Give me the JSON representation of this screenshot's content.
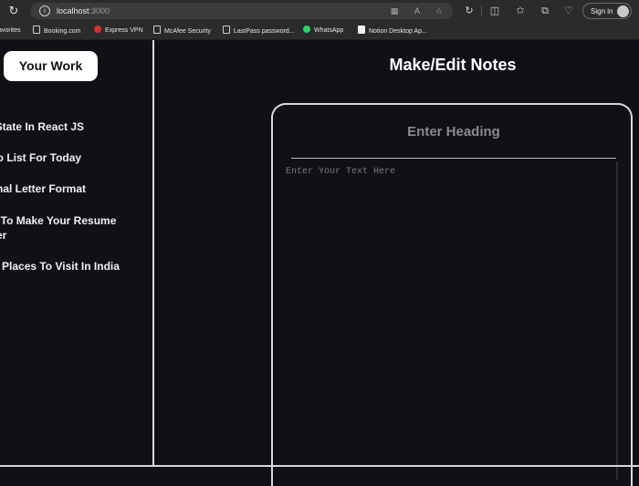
{
  "browser": {
    "url_host": "localhost",
    "url_port": ":3000",
    "signin_label": "Sign in"
  },
  "bookmarks": [
    {
      "label": "avorites"
    },
    {
      "label": "Booking.com"
    },
    {
      "label": "Express VPN"
    },
    {
      "label": "McAfee Security"
    },
    {
      "label": "LastPass password..."
    },
    {
      "label": "WhatsApp"
    },
    {
      "label": "Notion Desktop Ap..."
    }
  ],
  "sidebar": {
    "your_work_label": "Your Work",
    "notes": [
      {
        "title": "eState In React JS"
      },
      {
        "title": "Do List For Today"
      },
      {
        "title": "rmal Letter Format"
      },
      {
        "title": "w To Make Your Resume\ntter"
      },
      {
        "title": "st Places To Visit In India"
      }
    ]
  },
  "main": {
    "title": "Make/Edit Notes",
    "heading_placeholder": "Enter Heading",
    "text_placeholder": "Enter Your Text Here"
  }
}
